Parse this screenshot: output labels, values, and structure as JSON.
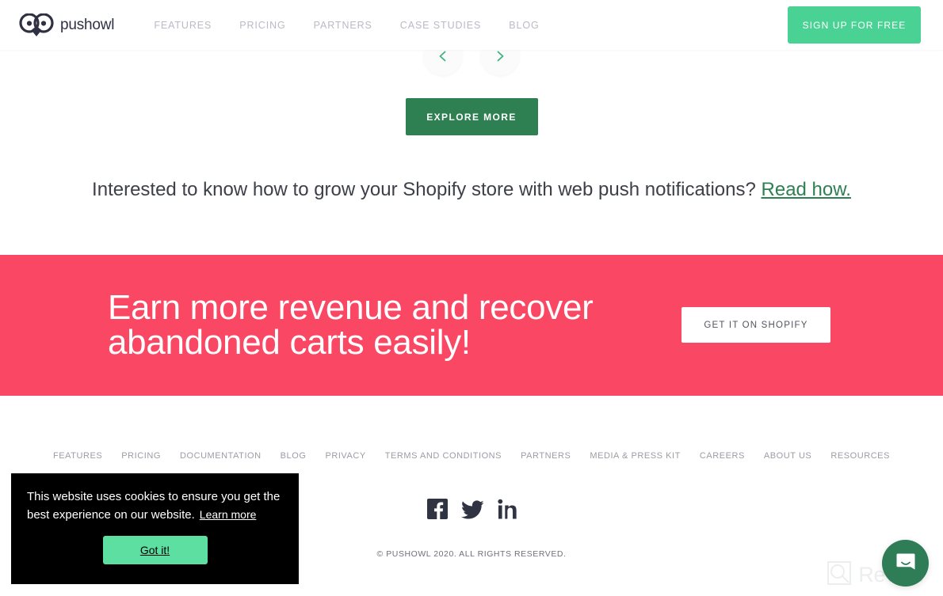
{
  "header": {
    "logo_text": "pushowl",
    "logo_icon": "owl-logo-icon",
    "nav": [
      {
        "label": "FEATURES"
      },
      {
        "label": "PRICING"
      },
      {
        "label": "PARTNERS"
      },
      {
        "label": "CASE STUDIES"
      },
      {
        "label": "BLOG"
      }
    ],
    "signup_label": "SIGN UP FOR FREE",
    "signup_color": "#4ad295"
  },
  "carousel": {
    "prev_icon": "chevron-left-icon",
    "next_icon": "chevron-right-icon",
    "arrow_color": "#3cb37e"
  },
  "explore": {
    "label": "EXPLORE MORE",
    "color": "#2e8052"
  },
  "interest": {
    "text": "Interested to know how to grow your Shopify store with web push notifications?",
    "link_label": "Read how."
  },
  "banner": {
    "heading_line1": "Earn more revenue and recover",
    "heading_line2": "abandoned carts easily!",
    "cta_label": "GET IT ON SHOPIFY",
    "background": "#fa4763"
  },
  "footer": {
    "links": [
      {
        "label": "FEATURES"
      },
      {
        "label": "PRICING"
      },
      {
        "label": "DOCUMENTATION"
      },
      {
        "label": "BLOG"
      },
      {
        "label": "PRIVACY"
      },
      {
        "label": "TERMS AND CONDITIONS"
      },
      {
        "label": "PARTNERS"
      },
      {
        "label": "MEDIA & PRESS KIT"
      },
      {
        "label": "CAREERS"
      },
      {
        "label": "ABOUT US"
      },
      {
        "label": "RESOURCES"
      }
    ],
    "social": [
      {
        "name": "facebook-icon"
      },
      {
        "name": "twitter-icon"
      },
      {
        "name": "linkedin-icon"
      }
    ],
    "copyright": "© PUSHOWL 2020. ALL RIGHTS RESERVED."
  },
  "cookie": {
    "message": "This website uses cookies to ensure you get the best experience on our website.",
    "learn_more_label": "Learn more",
    "accept_label": "Got it!",
    "accept_color": "#5ddfa2"
  },
  "chat": {
    "icon": "intercom-chat-icon",
    "color": "#2e7d56"
  },
  "watermark": {
    "text": "Revain",
    "icon": "revain-magnifier-icon"
  }
}
